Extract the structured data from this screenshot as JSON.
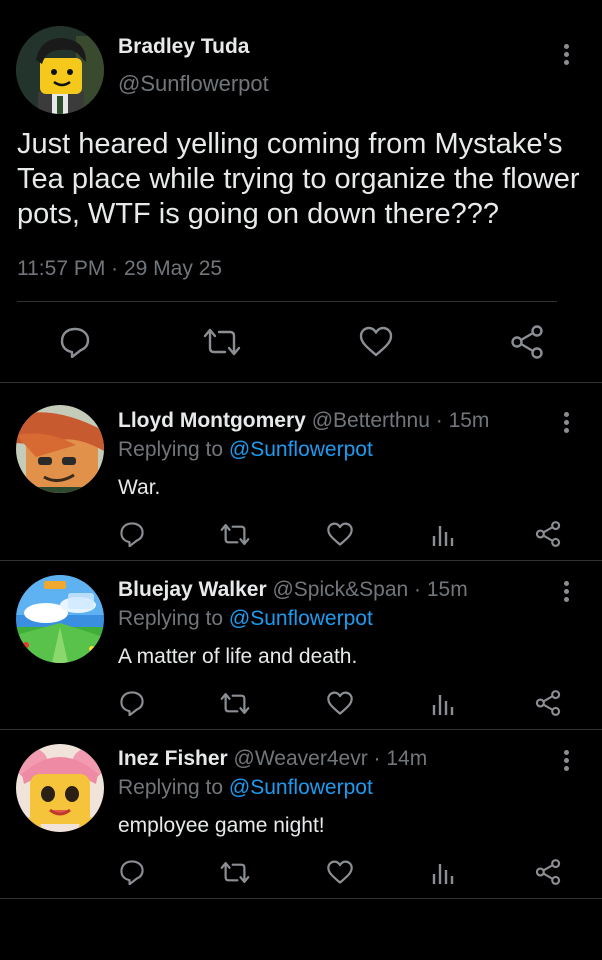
{
  "main_tweet": {
    "author_name": "Bradley Tuda",
    "author_handle": "@Sunflowerpot",
    "text": "Just heared yelling coming from Mystake's Tea place while trying to organize the flower pots, WTF is going on down there???",
    "timestamp": "11:57 PM · 29 May 25",
    "actions": [
      "reply-icon",
      "retweet-icon",
      "like-icon",
      "share-icon"
    ]
  },
  "replies": [
    {
      "name": "Lloyd Montgomery",
      "meta": "@Betterthnu · 15m",
      "replying_prefix": "Replying to",
      "replying_handle": "@Sunflowerpot",
      "text": "War."
    },
    {
      "name": "Bluejay Walker",
      "meta": "@Spick&Span · 15m",
      "replying_prefix": "Replying to",
      "replying_handle": "@Sunflowerpot",
      "text": "A matter of life and death."
    },
    {
      "name": "Inez Fisher",
      "meta": "@Weaver4evr · 14m",
      "replying_prefix": "Replying to",
      "replying_handle": "@Sunflowerpot",
      "text": "employee game night!"
    }
  ],
  "colors": {
    "background": "#000000",
    "text": "#e7e9ea",
    "secondary": "#71767b",
    "accent": "#1d9bf0",
    "divider": "#2f3336"
  }
}
